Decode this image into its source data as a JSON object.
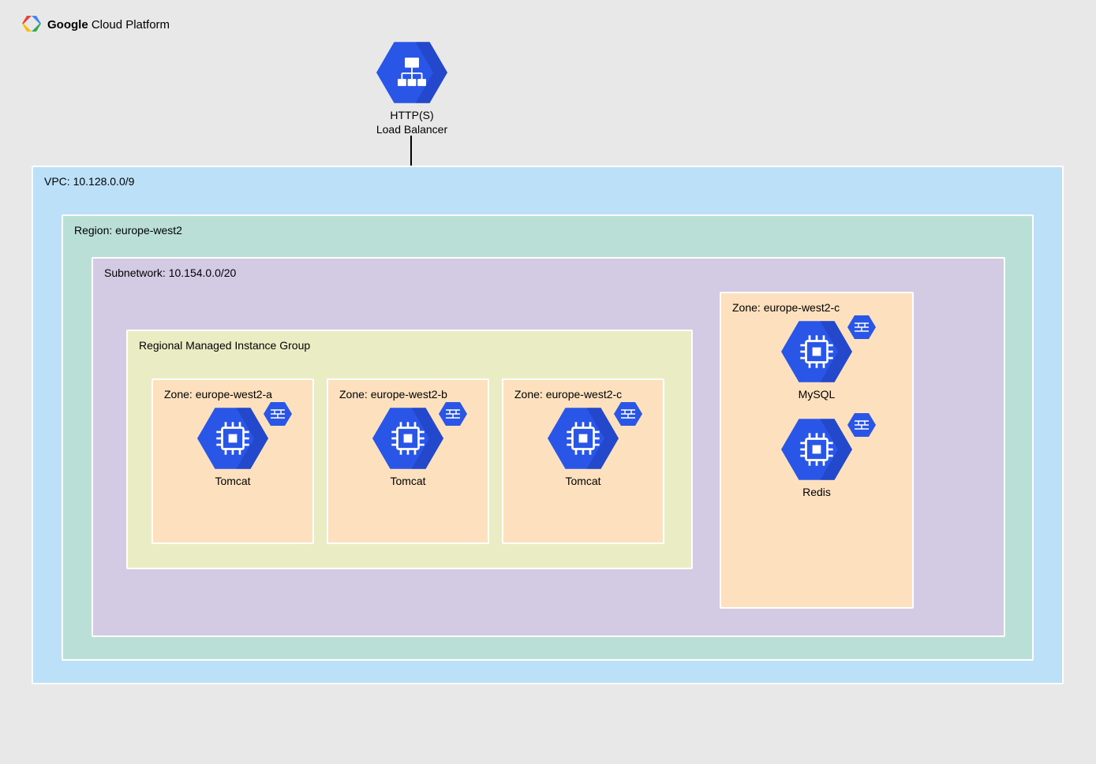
{
  "brand": {
    "name_bold": "Google",
    "name_light": " Cloud Platform"
  },
  "load_balancer": {
    "line1": "HTTP(S)",
    "line2": "Load Balancer",
    "icon": "load-balancer-icon"
  },
  "vpc": {
    "label": "VPC: 10.128.0.0/9"
  },
  "region": {
    "label": "Region: europe-west2"
  },
  "subnet": {
    "label": "Subnetwork: 10.154.0.0/20"
  },
  "mig": {
    "label": "Regional Managed Instance Group"
  },
  "zones": {
    "a": {
      "label": "Zone: europe-west2-a",
      "service": "Tomcat"
    },
    "b": {
      "label": "Zone: europe-west2-b",
      "service": "Tomcat"
    },
    "c": {
      "label": "Zone: europe-west2-c",
      "service": "Tomcat"
    },
    "db": {
      "label": "Zone: europe-west2-c",
      "service1": "MySQL",
      "service2": "Redis"
    }
  },
  "colors": {
    "hex_fill": "#2a56e8",
    "hex_shadow": "#1f3fb8",
    "icon_on_hex": "#ffffff"
  }
}
